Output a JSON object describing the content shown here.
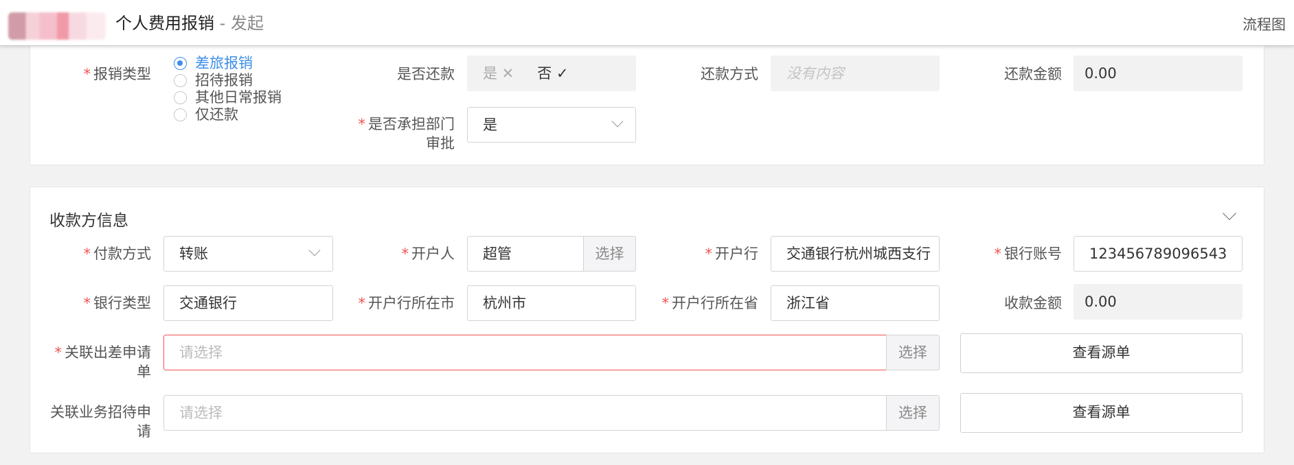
{
  "header": {
    "title_main": "个人费用报销",
    "title_sub": " - 发起",
    "flow_link": "流程图"
  },
  "reimbursement": {
    "type_label": "报销类型",
    "type_options": [
      {
        "label": "差旅报销",
        "checked": true
      },
      {
        "label": "招待报销",
        "checked": false
      },
      {
        "label": "其他日常报销",
        "checked": false
      },
      {
        "label": "仅还款",
        "checked": false
      }
    ],
    "repay_label": "是否还款",
    "repay_yes": "是 ✕",
    "repay_no": "否 ✓",
    "repay_method_label": "还款方式",
    "repay_method_placeholder": "没有内容",
    "repay_amount_label": "还款金额",
    "repay_amount_value": "0.00",
    "dept_approval_label_line1": "是否承担部门",
    "dept_approval_label_line2": "审批",
    "dept_approval_value": "是"
  },
  "payee": {
    "section_title": "收款方信息",
    "payment_method_label": "付款方式",
    "payment_method_value": "转账",
    "account_holder_label": "开户人",
    "account_holder_value": "超管",
    "select_label": "选择",
    "bank_label": "开户行",
    "bank_value": "交通银行杭州城西支行",
    "account_no_label": "银行账号",
    "account_no_value": "123456789096543",
    "bank_type_label": "银行类型",
    "bank_type_value": "交通银行",
    "bank_city_label": "开户行所在市",
    "bank_city_value": "杭州市",
    "bank_province_label": "开户行所在省",
    "bank_province_value": "浙江省",
    "receive_amount_label": "收款金额",
    "receive_amount_value": "0.00",
    "trip_request_label_line1": "关联出差申请",
    "trip_request_label_line2": "单",
    "trip_request_placeholder": "请选择",
    "entertain_request_label_line1": "关联业务招待申",
    "entertain_request_label_line2": "请",
    "entertain_request_placeholder": "请选择",
    "view_source_label": "查看源单"
  }
}
